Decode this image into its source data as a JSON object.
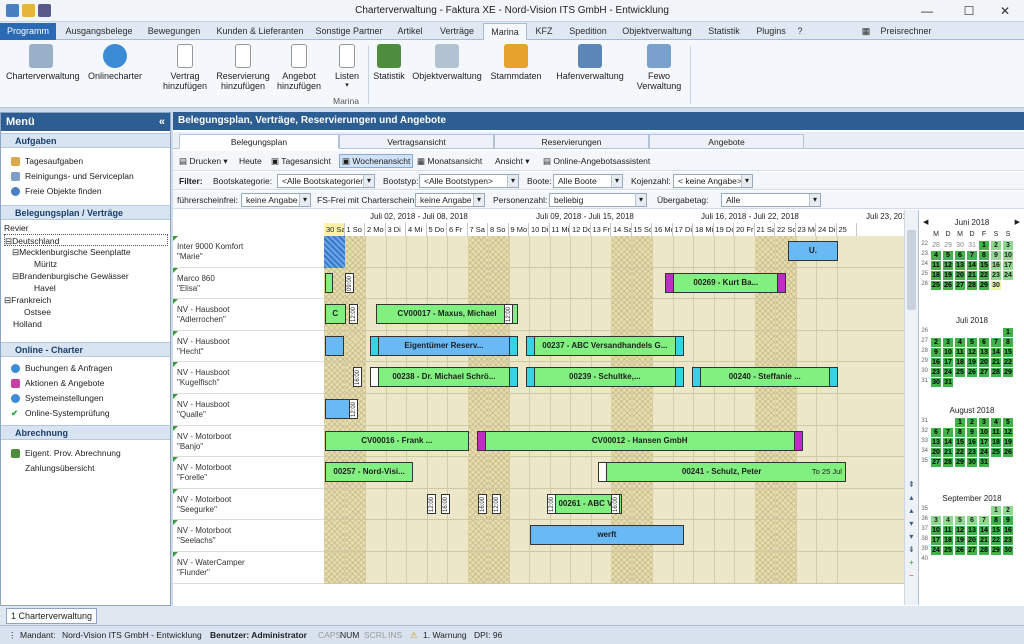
{
  "window": {
    "title": "Charterverwaltung - Faktura XE - Nord-Vision ITS GmbH - Entwicklung",
    "minimize": "—",
    "maximize": "☐",
    "close": "✕"
  },
  "ribbon_tabs": [
    "Programm",
    "Ausgangsbelege",
    "Bewegungen",
    "Kunden & Lieferanten",
    "Sonstige Partner",
    "Artikel",
    "Verträge",
    "Marina",
    "KFZ",
    "Spedition",
    "Objektverwaltung",
    "Statistik",
    "Plugins"
  ],
  "ribbon_right": {
    "preisrechner": "Preisrechner"
  },
  "ribbon_buttons": [
    {
      "label": "Charterverwaltung",
      "icon": "sailboat-icon"
    },
    {
      "label": "Onlinecharter",
      "icon": "globe-icon"
    },
    {
      "label": "Vertrag\nhinzufügen",
      "icon": "document-icon"
    },
    {
      "label": "Reservierung\nhinzufügen",
      "icon": "document-icon"
    },
    {
      "label": "Angebot\nhinzufügen",
      "icon": "document-icon"
    },
    {
      "label": "Listen",
      "icon": "list-icon"
    },
    {
      "label": "Statistik",
      "icon": "chart-icon"
    },
    {
      "label": "Objektverwaltung",
      "icon": "boat-icon"
    },
    {
      "label": "Stammdaten",
      "icon": "folder-icon"
    },
    {
      "label": "Hafenverwaltung",
      "icon": "anchor-icon"
    },
    {
      "label": "Fewo\nVerwaltung",
      "icon": "building-icon"
    }
  ],
  "ribbon_group_label": "Marina",
  "menu": {
    "title": "Menü",
    "aufgaben": {
      "header": "Aufgaben",
      "items": [
        "Tagesaufgaben",
        "Reinigungs- und Serviceplan",
        "Freie Objekte finden"
      ]
    },
    "belegungsplan": {
      "header": "Belegungsplan / Verträge",
      "tree": [
        {
          "label": "Revier",
          "indent": 0
        },
        {
          "label": "Deutschland",
          "indent": 1,
          "toggle": "⊟"
        },
        {
          "label": "Mecklenburgische Seenplatte",
          "indent": 2,
          "toggle": "⊟"
        },
        {
          "label": "Müritz",
          "indent": 3
        },
        {
          "label": "Brandenburgische Gewässer",
          "indent": 2,
          "toggle": "⊟"
        },
        {
          "label": "Havel",
          "indent": 3
        },
        {
          "label": "Frankreich",
          "indent": 1,
          "toggle": "⊟"
        },
        {
          "label": "Ostsee",
          "indent": 2
        },
        {
          "label": "Holland",
          "indent": 1
        }
      ]
    },
    "online": {
      "header": "Online - Charter",
      "items": [
        "Buchungen & Anfragen",
        "Aktionen & Angebote",
        "Systemeinstellungen",
        "Online-Systemprüfung"
      ]
    },
    "abrechnung": {
      "header": "Abrechnung",
      "items": [
        "Eigent. Prov. Abrechnung",
        "Zahlungsübersicht"
      ]
    }
  },
  "main": {
    "header": "Belegungsplan, Verträge, Reservierungen und Angebote",
    "tabs": [
      "Belegungsplan",
      "Vertragsansicht",
      "Reservierungen",
      "Angebote"
    ],
    "toolbar": [
      "Drucken",
      "Heute",
      "Tagesansicht",
      "Wochenansicht",
      "Monatsansicht",
      "Ansicht",
      "Online-Angebotsassistent"
    ],
    "filter1": {
      "label": "Filter:",
      "bootskategorie_label": "Bootskategorie:",
      "bootskategorie": "<Alle Bootskategorien>",
      "bootstyp_label": "Bootstyp:",
      "bootstyp": "<Alle Bootstypen>",
      "boote_label": "Boote:",
      "boote": "Alle Boote",
      "kojen_label": "Kojenzahl:",
      "kojen": "< keine Angabe>"
    },
    "filter2": {
      "fs_label": "führerscheinfrei:",
      "fs": "keine Angabe",
      "fsfrei_label": "FS-Frei mit Charterschein:",
      "fsfrei": "keine Angabe",
      "personen_label": "Personenzahl:",
      "personen": "beliebig",
      "uebergabe_label": "Übergabetag:",
      "uebergabe": "Alle"
    },
    "weeks": [
      "Juli 02, 2018 - Juli 08, 2018",
      "Juli 09, 2018 - Juli 15, 2018",
      "Juli 16, 2018 - Juli 22, 2018",
      "Juli 23, 201"
    ],
    "days": [
      "30 Sa",
      "1 So",
      "2 Mo",
      "3 Di",
      "4 Mi",
      "5 Do",
      "6 Fr",
      "7 Sa",
      "8 So",
      "9 Mo",
      "10 Di",
      "11 Mi",
      "12 Do",
      "13 Fr",
      "14 Sa",
      "15 So",
      "16 Mo",
      "17 Di",
      "18 Mi",
      "19 Do",
      "20 Fr",
      "21 Sa",
      "22 So",
      "23 Mo",
      "24 Di",
      "25"
    ],
    "rows": [
      {
        "type": "Inter 9000 Komfort",
        "name": "\"Marie\""
      },
      {
        "type": "Marco 860",
        "name": "\"Elisa\""
      },
      {
        "type": "NV - Hausboot",
        "name": "\"Adlerrochen\""
      },
      {
        "type": "NV - Hausboot",
        "name": "\"Hecht\""
      },
      {
        "type": "NV - Hausboot",
        "name": "\"Kugelfisch\""
      },
      {
        "type": "NV - Hausboot",
        "name": "\"Qualle\""
      },
      {
        "type": "NV - Motorboot",
        "name": "\"Banjo\""
      },
      {
        "type": "NV - Motorboot",
        "name": "\"Forelle\""
      },
      {
        "type": "NV - Motorboot",
        "name": "\"Seegurke\""
      },
      {
        "type": "NV - Motorboot",
        "name": "\"Seelachs\""
      },
      {
        "type": "NV - WaterCamper",
        "name": "\"Flunder\""
      }
    ],
    "bookings": {
      "u": "U.",
      "kurt": "00269 - Kurt Ba...",
      "maxus": "CV00017 - Maxus, Michael",
      "eig": "Eigentümer Reserv...",
      "abc1": "00237 - ABC Versandhandels G...",
      "schroe": "00238 - Dr. Michael Schrö...",
      "schultke": "00239 - Schultke,...",
      "steff": "00240 - Steffanie ...",
      "frank": "CV00016 - Frank ...",
      "hansen": "CV00012 - Hansen GmbH",
      "nordvisi": "00257 - Nord-Visi...",
      "schulz": "00241 - Schulz, Peter",
      "to25": "To 25 Jul",
      "abc2": "00261 - ABC V...",
      "werft": "werft",
      "c": "C",
      "t0900": "09:00",
      "t1200": "12:00",
      "t1600": "16:00",
      "t1100": "11:00",
      "t1300": "13:00",
      "t0000": "00:00"
    }
  },
  "calendar": {
    "months": [
      {
        "title": "Juni 2018",
        "nav": true
      },
      {
        "title": "Juli 2018"
      },
      {
        "title": "August 2018"
      },
      {
        "title": "September 2018"
      }
    ],
    "weekday_header": [
      "M",
      "D",
      "M",
      "D",
      "F",
      "S",
      "S"
    ],
    "prev": "◀",
    "next": "▶"
  },
  "taskbar": {
    "item": "1 Charterverwaltung"
  },
  "status": {
    "mandant_label": "Mandant:",
    "mandant": "Nord-Vision ITS GmbH - Entwicklung",
    "benutzer": "Benutzer: Administrator",
    "caps": "CAPS",
    "num": "NUM",
    "scrl": "SCRL",
    "ins": "INS",
    "warn": "1. Warnung",
    "dpi": "DPI: 96"
  },
  "colors": {
    "accent": "#2c5d93",
    "booking_green": "#82f081",
    "booking_blue": "#69b9f5",
    "magenta": "#c12cc8",
    "cyan": "#35d3e4"
  }
}
